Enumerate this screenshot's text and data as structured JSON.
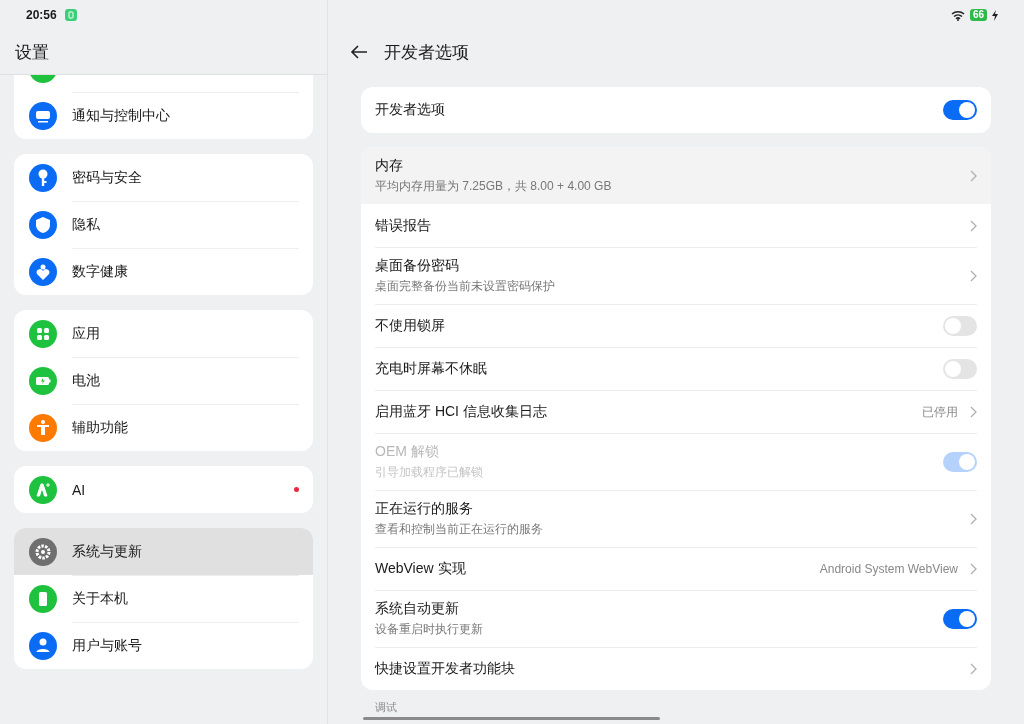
{
  "status_bar": {
    "time": "20:56",
    "battery": "66",
    "charging": true
  },
  "sidebar": {
    "title": "设置",
    "groups": [
      {
        "items": [
          {
            "kind": "partial",
            "selected": false
          },
          {
            "kind": "notify",
            "label": "通知与控制中心",
            "selected": false
          }
        ]
      },
      {
        "items": [
          {
            "kind": "key",
            "label": "密码与安全",
            "selected": false
          },
          {
            "kind": "shield",
            "label": "隐私",
            "selected": false
          },
          {
            "kind": "heart",
            "label": "数字健康",
            "selected": false
          }
        ]
      },
      {
        "items": [
          {
            "kind": "apps",
            "label": "应用",
            "selected": false
          },
          {
            "kind": "battery",
            "label": "电池",
            "selected": false
          },
          {
            "kind": "access",
            "label": "辅助功能",
            "selected": false
          }
        ]
      },
      {
        "items": [
          {
            "kind": "ai",
            "label": "AI",
            "selected": false,
            "dot": true
          }
        ]
      },
      {
        "items": [
          {
            "kind": "gear",
            "label": "系统与更新",
            "selected": true
          },
          {
            "kind": "phone",
            "label": "关于本机",
            "selected": false
          },
          {
            "kind": "user",
            "label": "用户与账号",
            "selected": false
          }
        ]
      }
    ]
  },
  "page": {
    "title": "开发者选项",
    "master": {
      "title": "开发者选项",
      "on": true
    },
    "rows": [
      {
        "kind": "link",
        "title": "内存",
        "subtitle": "平均内存用量为 7.25GB，共 8.00 + 4.00 GB",
        "highlighted": true
      },
      {
        "kind": "link",
        "title": "错误报告",
        "highlighted": false
      },
      {
        "kind": "link",
        "title": "桌面备份密码",
        "subtitle": "桌面完整备份当前未设置密码保护",
        "highlighted": false
      },
      {
        "kind": "toggle",
        "title": "不使用锁屏",
        "on": false,
        "disabled": false
      },
      {
        "kind": "toggle",
        "title": "充电时屏幕不休眠",
        "on": false,
        "disabled": false
      },
      {
        "kind": "link",
        "title": "启用蓝牙 HCI 信息收集日志",
        "value": "已停用",
        "highlighted": false
      },
      {
        "kind": "toggle",
        "title": "OEM 解锁",
        "subtitle": "引导加载程序已解锁",
        "on": true,
        "disabled": true
      },
      {
        "kind": "link",
        "title": "正在运行的服务",
        "subtitle": "查看和控制当前正在运行的服务",
        "highlighted": false
      },
      {
        "kind": "link",
        "title": "WebView 实现",
        "value": "Android System WebView",
        "highlighted": false
      },
      {
        "kind": "toggle",
        "title": "系统自动更新",
        "subtitle": "设备重启时执行更新",
        "on": true,
        "disabled": false
      },
      {
        "kind": "link",
        "title": "快捷设置开发者功能块",
        "highlighted": false
      }
    ],
    "next_section": "调试"
  }
}
